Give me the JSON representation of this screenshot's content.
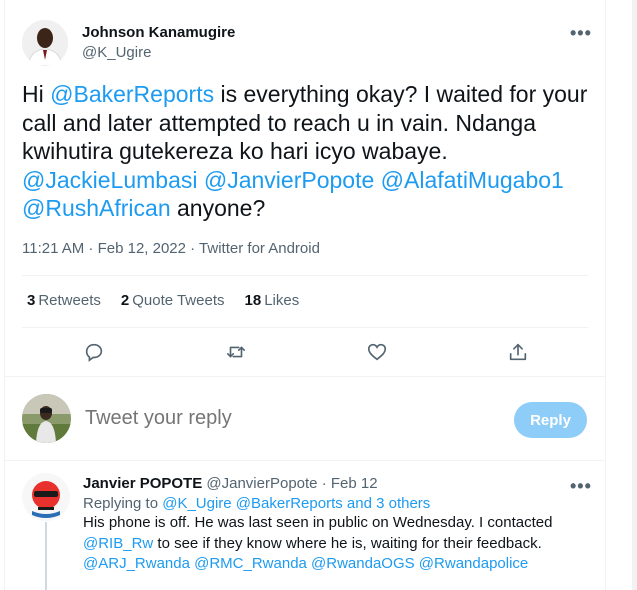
{
  "tweet": {
    "author_name": "Johnson Kanamugire",
    "author_handle": "@K_Ugire",
    "more_label": "•••",
    "text_parts": {
      "p1": "Hi ",
      "mention1": "@BakerReports",
      "p2": " is everything okay? I waited for your call and later attempted to reach u in vain. Ndanga kwihutira gutekereza ko hari icyo wabaye. ",
      "mention2": "@JackieLumbasi",
      "mention3": "@JanvierPopote",
      "mention4": "@AlafatiMugabo1",
      "mention5": "@RushAfrican",
      "p3": " anyone?"
    },
    "meta": "11:21 AM · Feb 12, 2022 · Twitter for Android",
    "stats": {
      "retweets_count": "3",
      "retweets_label": "Retweets",
      "quotes_count": "2",
      "quotes_label": "Quote Tweets",
      "likes_count": "18",
      "likes_label": "Likes"
    }
  },
  "actions": [
    "reply-icon",
    "retweet-icon",
    "like-icon",
    "share-icon"
  ],
  "composer": {
    "placeholder": "Tweet your reply",
    "reply_button": "Reply"
  },
  "reply": {
    "author_name": "Janvier POPOTE",
    "author_handle": "@JanvierPopote",
    "date": "· Feb 12",
    "replying_prefix": "Replying to ",
    "replying_to": "@K_Ugire @BakerReports and 3 others",
    "body_p1": "His phone is off. He was last seen in public on Wednesday. I contacted ",
    "body_mention1": "@RIB_Rw",
    "body_p2": " to see if they know where he is, waiting for their feedback.",
    "body_mentions2": "@ARJ_Rwanda @RMC_Rwanda @RwandaOGS @Rwandapolice"
  },
  "colors": {
    "link": "#1d9bf0",
    "secondary_text": "#536471",
    "reply_button_bg": "#8ecdf8"
  }
}
